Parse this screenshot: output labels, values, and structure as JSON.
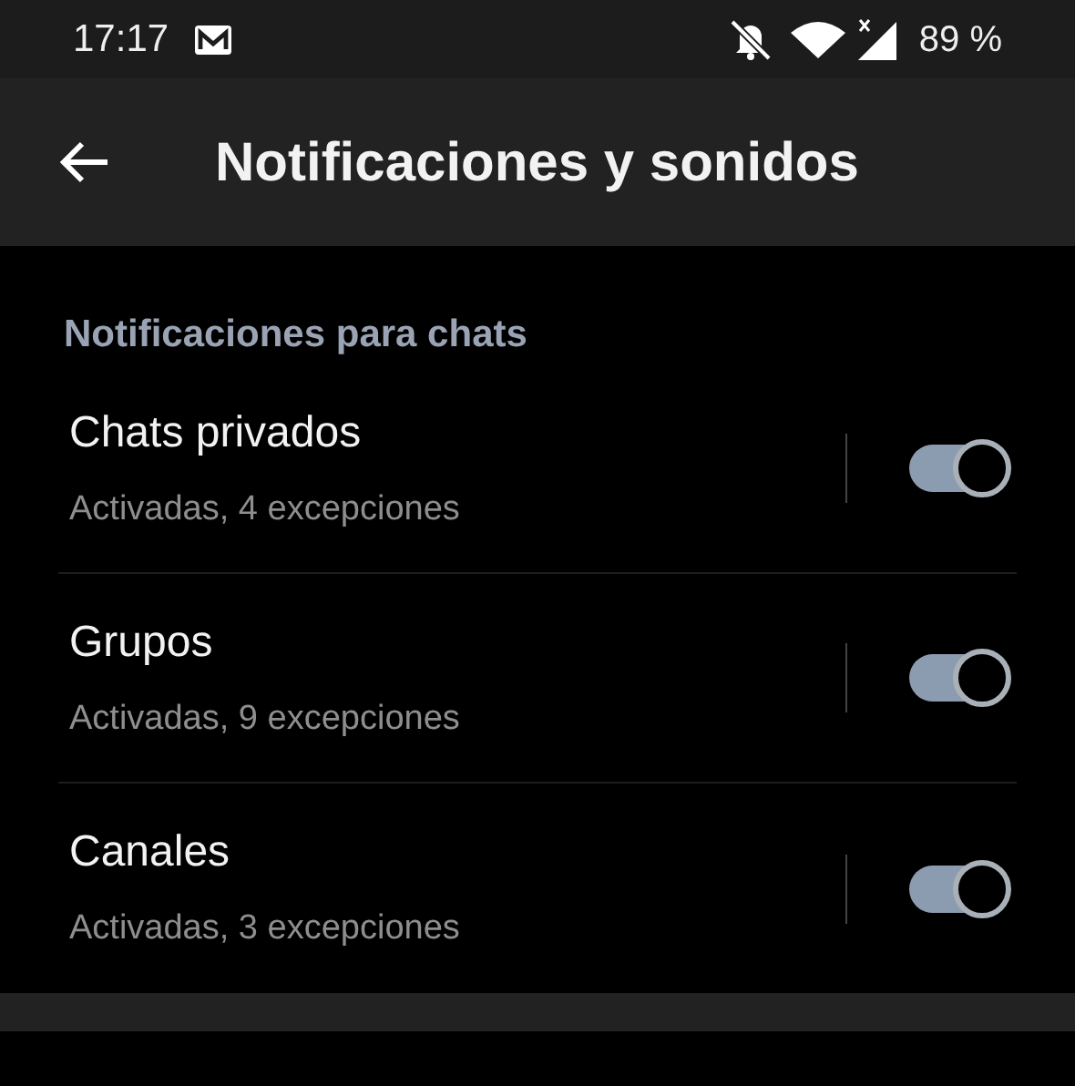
{
  "status_bar": {
    "time": "17:17",
    "battery": "89 %"
  },
  "toolbar": {
    "title": "Notificaciones y sonidos"
  },
  "section": {
    "header": "Notificaciones para chats",
    "items": [
      {
        "title": "Chats privados",
        "subtitle": "Activadas, 4 excepciones",
        "on": true
      },
      {
        "title": "Grupos",
        "subtitle": "Activadas, 9 excepciones",
        "on": true
      },
      {
        "title": "Canales",
        "subtitle": "Activadas, 3 excepciones",
        "on": true
      }
    ]
  }
}
